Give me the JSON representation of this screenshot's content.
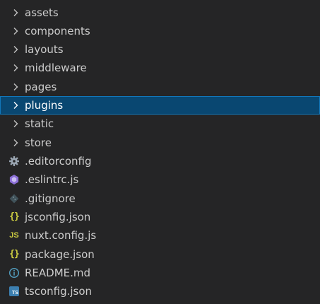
{
  "explorer": {
    "folders": [
      {
        "label": "assets",
        "icon": "chevron-right-icon"
      },
      {
        "label": "components",
        "icon": "chevron-right-icon"
      },
      {
        "label": "layouts",
        "icon": "chevron-right-icon"
      },
      {
        "label": "middleware",
        "icon": "chevron-right-icon"
      },
      {
        "label": "pages",
        "icon": "chevron-right-icon"
      },
      {
        "label": "plugins",
        "icon": "chevron-right-icon",
        "selected": true
      },
      {
        "label": "static",
        "icon": "chevron-right-icon"
      },
      {
        "label": "store",
        "icon": "chevron-right-icon"
      }
    ],
    "files": [
      {
        "label": ".editorconfig",
        "icon": "gear-icon"
      },
      {
        "label": ".eslintrc.js",
        "icon": "eslint-icon"
      },
      {
        "label": ".gitignore",
        "icon": "git-icon"
      },
      {
        "label": "jsconfig.json",
        "icon": "json-braces-icon",
        "glyph": "{}"
      },
      {
        "label": "nuxt.config.js",
        "icon": "javascript-icon",
        "glyph": "JS"
      },
      {
        "label": "package.json",
        "icon": "json-braces-icon",
        "glyph": "{}"
      },
      {
        "label": "README.md",
        "icon": "info-icon"
      },
      {
        "label": "tsconfig.json",
        "icon": "typescript-icon",
        "glyph": "TS"
      }
    ]
  },
  "colors": {
    "background": "#252526",
    "text": "#cccccc",
    "selection": "#094771",
    "selection_border": "#1177bb",
    "json_yellow": "#cbcb41",
    "eslint_purple": "#8b6fd6",
    "info_blue": "#519aba",
    "ts_blue": "#3c7fb0",
    "muted_icon": "#6d8086"
  }
}
